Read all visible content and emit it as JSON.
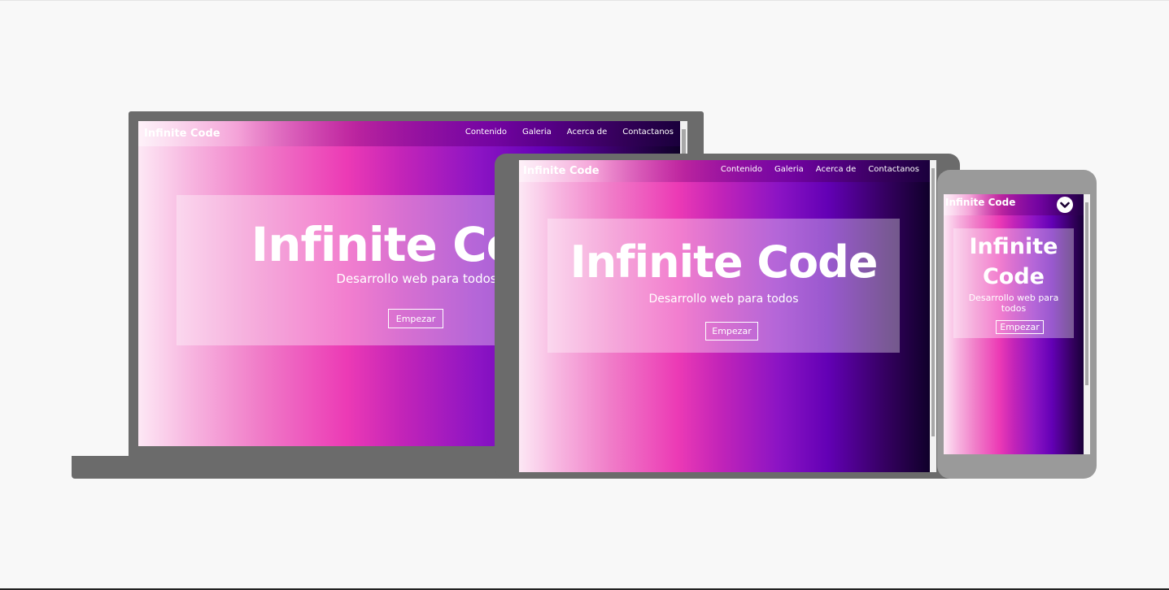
{
  "site": {
    "brand": "Infinite Code",
    "nav": [
      "Contenido",
      "Galeria",
      "Acerca de",
      "Contactanos"
    ],
    "hero_title": "Infinite Code",
    "hero_subtitle": "Desarrollo web para todos",
    "cta_label": "Empezar"
  },
  "mobile": {
    "hero_title_line1": "Infinite",
    "hero_title_line2": "Code",
    "hero_subtitle_line1": "Desarrollo web para",
    "hero_subtitle_line2": "todos",
    "menu_icon": "chevron-down-icon"
  },
  "colors": {
    "page_background": "#f8f8f8",
    "laptop_frame": "#6b6b6b",
    "tablet_frame": "#6b6b6b",
    "phone_frame": "#9a9a9a",
    "gradient": [
      "#fde8f5",
      "#ec3ab5",
      "#6300b5",
      "#0a0022"
    ]
  }
}
